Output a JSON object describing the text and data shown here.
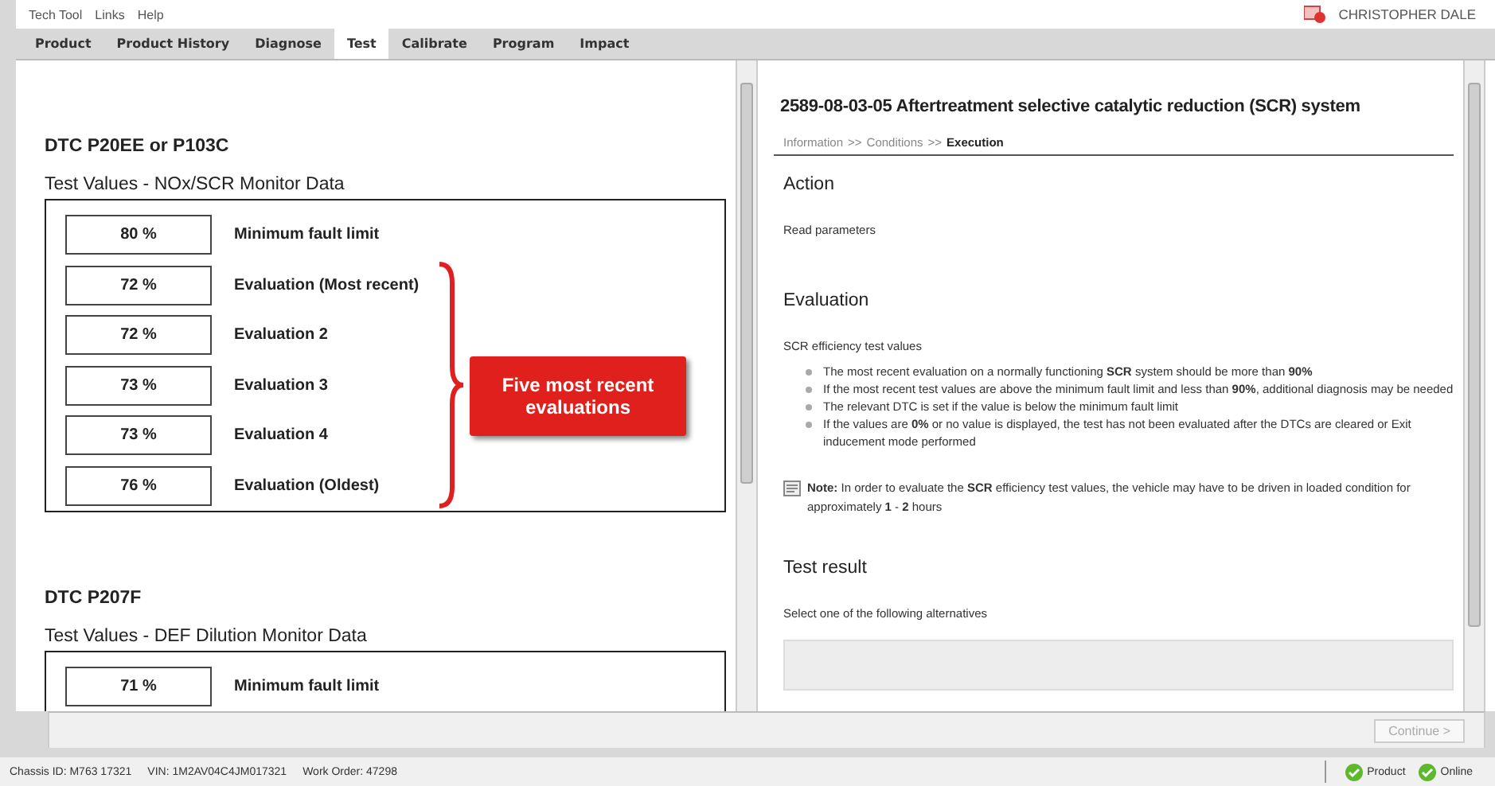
{
  "menu": [
    "Tech Tool",
    "Links",
    "Help"
  ],
  "user": "CHRISTOPHER DALE",
  "tabs": [
    {
      "label": "Product",
      "selected": false
    },
    {
      "label": "Product History",
      "selected": false
    },
    {
      "label": "Diagnose",
      "selected": false
    },
    {
      "label": "Test",
      "selected": true
    },
    {
      "label": "Calibrate",
      "selected": false
    },
    {
      "label": "Program",
      "selected": false
    },
    {
      "label": "Impact",
      "selected": false
    }
  ],
  "left_sections": [
    {
      "heading": "DTC P20EE or P103C",
      "subheading": "Test Values - NOx/SCR Monitor Data",
      "rows": [
        {
          "value": "80 %",
          "label": "Minimum fault limit"
        },
        {
          "value": "72 %",
          "label": "Evaluation (Most recent)"
        },
        {
          "value": "72 %",
          "label": "Evaluation 2"
        },
        {
          "value": "73 %",
          "label": "Evaluation 3"
        },
        {
          "value": "73 %",
          "label": "Evaluation 4"
        },
        {
          "value": "76 %",
          "label": "Evaluation (Oldest)"
        }
      ],
      "callout": "Five most recent evaluations"
    },
    {
      "heading": "DTC P207F",
      "subheading": "Test Values - DEF Dilution Monitor Data",
      "rows": [
        {
          "value": "71 %",
          "label": "Minimum fault limit"
        }
      ]
    }
  ],
  "right": {
    "title": "2589-08-03-05 Aftertreatment selective catalytic reduction (SCR) system",
    "breadcrumb": [
      {
        "label": "Information",
        "selected": false
      },
      {
        "label": ">>",
        "selected": false
      },
      {
        "label": "Conditions",
        "selected": false
      },
      {
        "label": ">>",
        "selected": false
      },
      {
        "label": "Execution",
        "selected": true
      }
    ],
    "action_heading": "Action",
    "action_text": "Read parameters",
    "evaluation_heading": "Evaluation",
    "evaluation_intro": "SCR efficiency test values",
    "bullets": [
      "The most recent evaluation on a normally functioning **SCR** system should be more than **90%**",
      "If the most recent test values are above the minimum fault limit and less than **90%**, additional diagnosis may be needed",
      "The relevant DTC is set if the value is below the minimum fault limit",
      "If the values are **0%** or no value is displayed, the test has not been evaluated after the DTCs are cleared or Exit inducement mode performed"
    ],
    "note": "**Note:** In order to evaluate the **SCR** efficiency test values, the vehicle may have to be driven in loaded condition for approximately **1** - **2** hours",
    "result_heading": "Test result",
    "result_text": "Select one of the following alternatives"
  },
  "continue_button": {
    "label": "Continue >",
    "disabled": true
  },
  "status": [
    "Chassis ID: M763 17321",
    "VIN: 1M2AV04C4JM017321",
    "Work Order: 47298"
  ],
  "indicators": [
    {
      "label": "Product",
      "ok": true
    },
    {
      "label": "Online",
      "ok": true
    }
  ]
}
